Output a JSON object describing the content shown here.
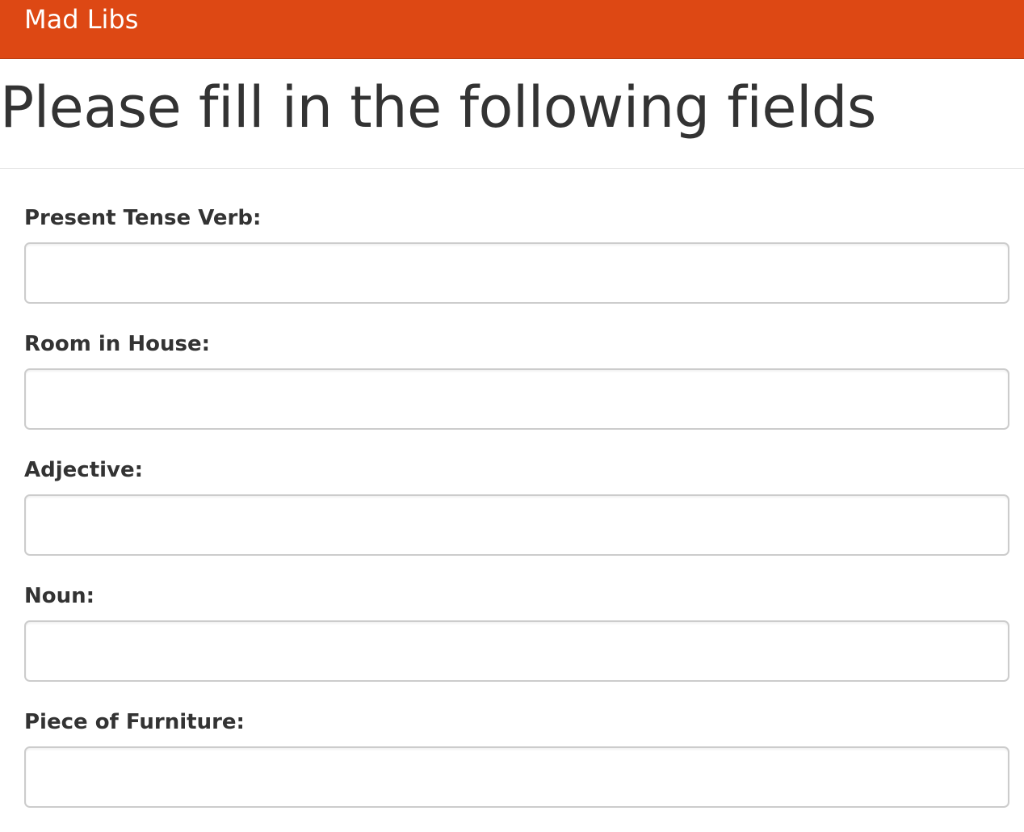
{
  "navbar": {
    "brand": "Mad Libs",
    "color": "#dd4814"
  },
  "header": {
    "title": "Please fill in the following fields"
  },
  "form": {
    "fields": [
      {
        "label": "Present Tense Verb:",
        "value": "",
        "placeholder": ""
      },
      {
        "label": "Room in House:",
        "value": "",
        "placeholder": ""
      },
      {
        "label": "Adjective:",
        "value": "",
        "placeholder": ""
      },
      {
        "label": "Noun:",
        "value": "",
        "placeholder": ""
      },
      {
        "label": "Piece of Furniture:",
        "value": "",
        "placeholder": ""
      }
    ]
  }
}
